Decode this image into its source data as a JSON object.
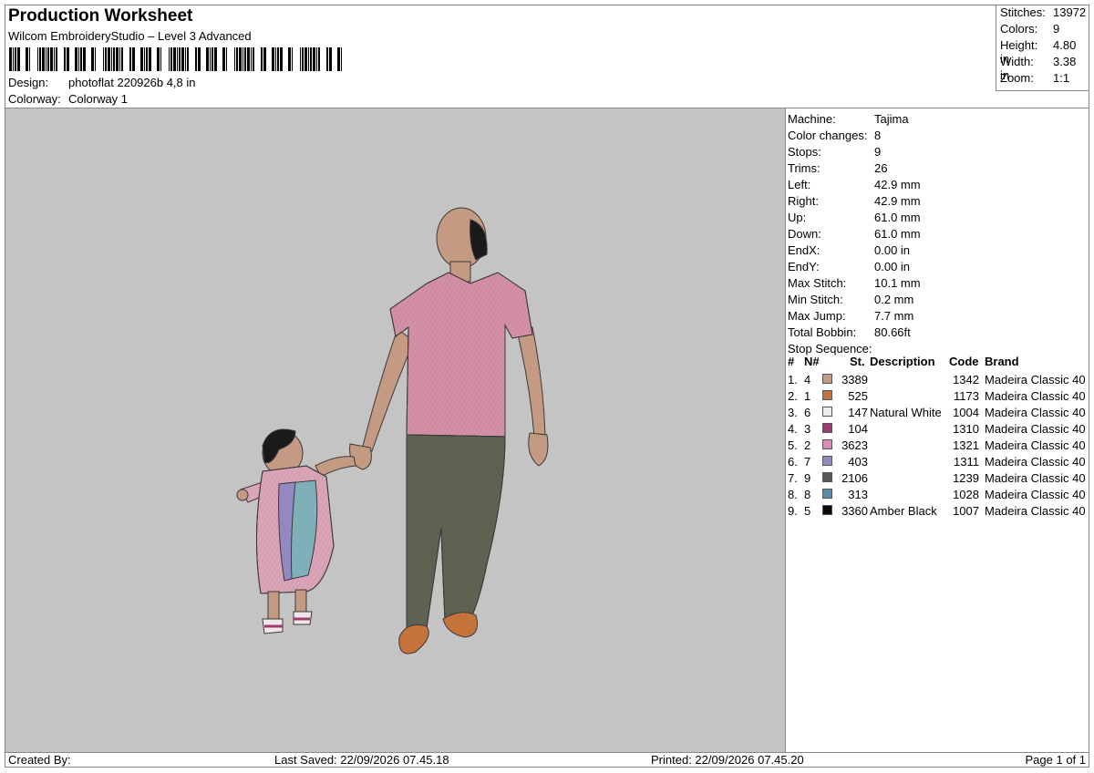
{
  "header": {
    "title": "Production Worksheet",
    "software": "Wilcom EmbroideryStudio – Level 3 Advanced",
    "design_label": "Design:",
    "design_value": "photoflat 220926b 4,8 in",
    "colorway_label": "Colorway:",
    "colorway_value": "Colorway 1"
  },
  "summary": [
    {
      "label": "Stitches:",
      "value": "13972"
    },
    {
      "label": "Colors:",
      "value": "9"
    },
    {
      "label": "Height:",
      "value": "4.80 in"
    },
    {
      "label": "Width:",
      "value": "3.38 in"
    },
    {
      "label": "Zoom:",
      "value": "1:1"
    }
  ],
  "properties": [
    {
      "label": "Machine:",
      "value": "Tajima"
    },
    {
      "label": "Color changes:",
      "value": "8"
    },
    {
      "label": "Stops:",
      "value": "9"
    },
    {
      "label": "Trims:",
      "value": "26"
    },
    {
      "label": "Left:",
      "value": "42.9 mm"
    },
    {
      "label": "Right:",
      "value": "42.9 mm"
    },
    {
      "label": "Up:",
      "value": "61.0 mm"
    },
    {
      "label": "Down:",
      "value": "61.0 mm"
    },
    {
      "label": "EndX:",
      "value": "0.00 in"
    },
    {
      "label": "EndY:",
      "value": "0.00 in"
    },
    {
      "label": "Max Stitch:",
      "value": "10.1 mm"
    },
    {
      "label": "Min Stitch:",
      "value": "0.2 mm"
    },
    {
      "label": "Max Jump:",
      "value": "7.7 mm"
    },
    {
      "label": "Total Bobbin:",
      "value": "80.66ft"
    },
    {
      "label": "Stop Sequence:",
      "value": ""
    }
  ],
  "table": {
    "columns": [
      "#",
      "N#",
      "St.",
      "Description",
      "Code",
      "Brand"
    ],
    "rows": [
      {
        "idx": "1.",
        "n": "4",
        "color": "#c49a82",
        "st": "3389",
        "desc": "",
        "code": "1342",
        "brand": "Madeira Classic 40"
      },
      {
        "idx": "2.",
        "n": "1",
        "color": "#c4743a",
        "st": "525",
        "desc": "",
        "code": "1173",
        "brand": "Madeira Classic 40"
      },
      {
        "idx": "3.",
        "n": "6",
        "color": "#ececec",
        "st": "147",
        "desc": "Natural White",
        "code": "1004",
        "brand": "Madeira Classic 40"
      },
      {
        "idx": "4.",
        "n": "3",
        "color": "#9c3c70",
        "st": "104",
        "desc": "",
        "code": "1310",
        "brand": "Madeira Classic 40"
      },
      {
        "idx": "5.",
        "n": "2",
        "color": "#dc8cb4",
        "st": "3623",
        "desc": "",
        "code": "1321",
        "brand": "Madeira Classic 40"
      },
      {
        "idx": "6.",
        "n": "7",
        "color": "#9488c0",
        "st": "403",
        "desc": "",
        "code": "1311",
        "brand": "Madeira Classic 40"
      },
      {
        "idx": "7.",
        "n": "9",
        "color": "#585858",
        "st": "2106",
        "desc": "",
        "code": "1239",
        "brand": "Madeira Classic 40"
      },
      {
        "idx": "8.",
        "n": "8",
        "color": "#5a8cac",
        "st": "313",
        "desc": "",
        "code": "1028",
        "brand": "Madeira Classic 40"
      },
      {
        "idx": "9.",
        "n": "5",
        "color": "#0a0a0a",
        "st": "3360",
        "desc": "Amber Black",
        "code": "1007",
        "brand": "Madeira Classic 40"
      }
    ]
  },
  "footer": {
    "created_by": "Created By:",
    "last_saved": "Last Saved: 22/09/2026 07.45.18",
    "printed": "Printed: 22/09/2026 07.45.20",
    "page": "Page 1 of 1"
  }
}
